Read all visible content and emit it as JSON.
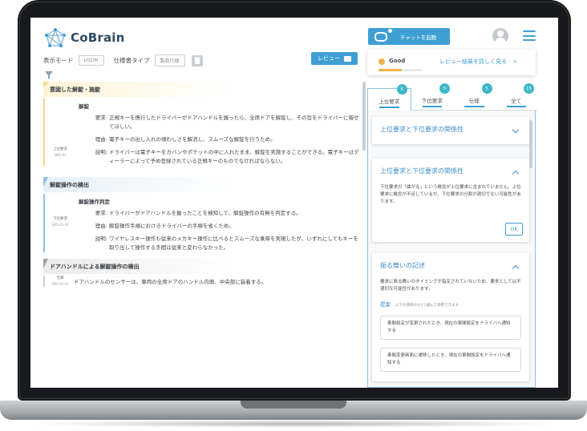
{
  "app": {
    "name": "CoBrain"
  },
  "toolbar": {
    "display_mode_label": "表示モード",
    "display_mode_value": "USDM",
    "spec_type_label": "仕様書タイプ",
    "spec_type_value": "製品仕様",
    "review_button": "レビュー"
  },
  "document": {
    "sections": [
      {
        "heading": "意図した解錠・施錠",
        "title": "解錠",
        "side_label": "上位要求",
        "side_id": "SMS-01",
        "rows": [
          {
            "label": "要求:",
            "text": "正規キーを携行したドライバーがドアハンドルを握ったら、全席ドアを解錠し、その旨をドライバーに報せてほしい。"
          },
          {
            "label": "理由:",
            "text": "電子キーの出し入れの煩わしさを解消し、スムーズな解錠を行うため。"
          },
          {
            "label": "説明:",
            "text": "ドライバーは電子キーをカバンやポケットの中に入れたまま、解錠を実施することができる。電子キーはディーラーによって予め登録されている正規キーのものでなければならない。"
          }
        ]
      },
      {
        "heading": "解錠操作の検出",
        "title": "解錠操作判定",
        "side_label": "下位要求",
        "side_id": "SMS-01-01",
        "rows": [
          {
            "label": "要求:",
            "text": "ドライバーがドアハンドルを握ったことを検知して、解錠操作の有無を判定する。"
          },
          {
            "label": "理由:",
            "text": "解錠操作手順におけるドライバーの手順を省くため。"
          },
          {
            "label": "説明:",
            "text": "ワイヤレスキー操作も従来のメカキー操作に比べるとスムーズな乗降を実現したが、いずれにしてもキーを取り出して操作する手間は従来と変わらなかった。"
          }
        ]
      },
      {
        "heading": "ドアハンドルによる解錠操作の検出",
        "side_label": "仕様",
        "side_id": "SMS-01-01",
        "rows": [
          {
            "label": "",
            "text": "ドアハンドルのセンサーは、車両の全席ドアのハンドル内側、中央部に装着する。"
          }
        ]
      }
    ]
  },
  "chat": {
    "button": "チャットを起動"
  },
  "status": {
    "label": "Good",
    "link": "レビュー結果を詳しく見る",
    "link_arrow": "»",
    "progress": 0.54,
    "color": "#f0b24a"
  },
  "tabs": [
    {
      "label": "上位要求",
      "count": "5"
    },
    {
      "label": "下位要求",
      "count": "5"
    },
    {
      "label": "仕様",
      "count": "5"
    },
    {
      "label": "全て",
      "count": "15"
    }
  ],
  "review_cards": [
    {
      "title": "上位要求と下位要求の関係性"
    },
    {
      "title": "上位要求と下位要求の関係性",
      "body": "下位要求の「曲がる」という概念が上位要求に含まれていません。上位要求に概念が不足しているか、下位要求の分割が適切でない可能性があります。",
      "ok": "OK"
    },
    {
      "title": "振る舞いの記述",
      "body": "要求に振る舞いのタイミングが指定されていないため、要求としては不適切な可能性があります。",
      "suggest_label": "提案",
      "suggest_hint": "以下の項目から1つ選んで適用できます",
      "suggestions": [
        "車間設定が変更されたとき、現在の車間設定をドライバへ通知する",
        "車間変更画面に遷移したとき、現在の車間設定をドライバへ通知する"
      ]
    }
  ],
  "colors": {
    "accent": "#3f9fd3",
    "badge": "#3fb8c8",
    "heading_yellow": "#f5d98a",
    "heading_blue": "#8fc0e6"
  }
}
